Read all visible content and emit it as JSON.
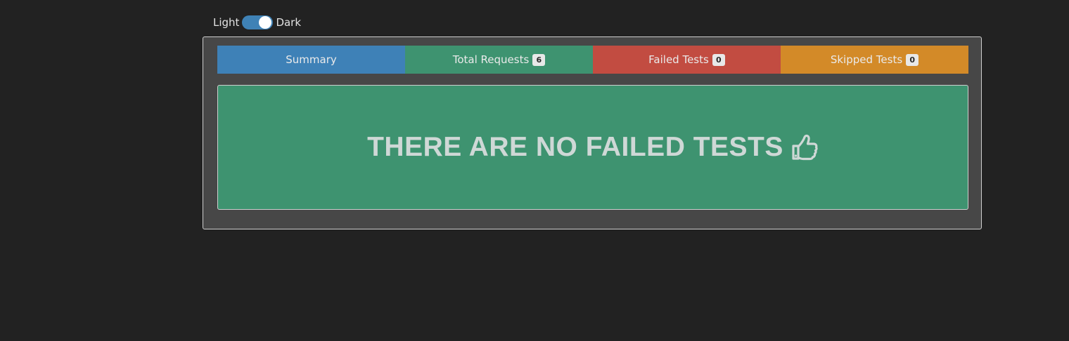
{
  "theme_toggle": {
    "light_label": "Light",
    "dark_label": "Dark",
    "state": "dark"
  },
  "tabs": [
    {
      "label": "Summary",
      "badge": null,
      "color": "#3e81b7"
    },
    {
      "label": "Total Requests",
      "badge": "6",
      "color": "#3e9370"
    },
    {
      "label": "Failed Tests",
      "badge": "0",
      "color": "#c24c41"
    },
    {
      "label": "Skipped Tests",
      "badge": "0",
      "color": "#d38a28"
    }
  ],
  "panel": {
    "message": "THERE ARE NO FAILED TESTS",
    "icon": "thumbs-up-icon",
    "color": "#3e9370"
  }
}
